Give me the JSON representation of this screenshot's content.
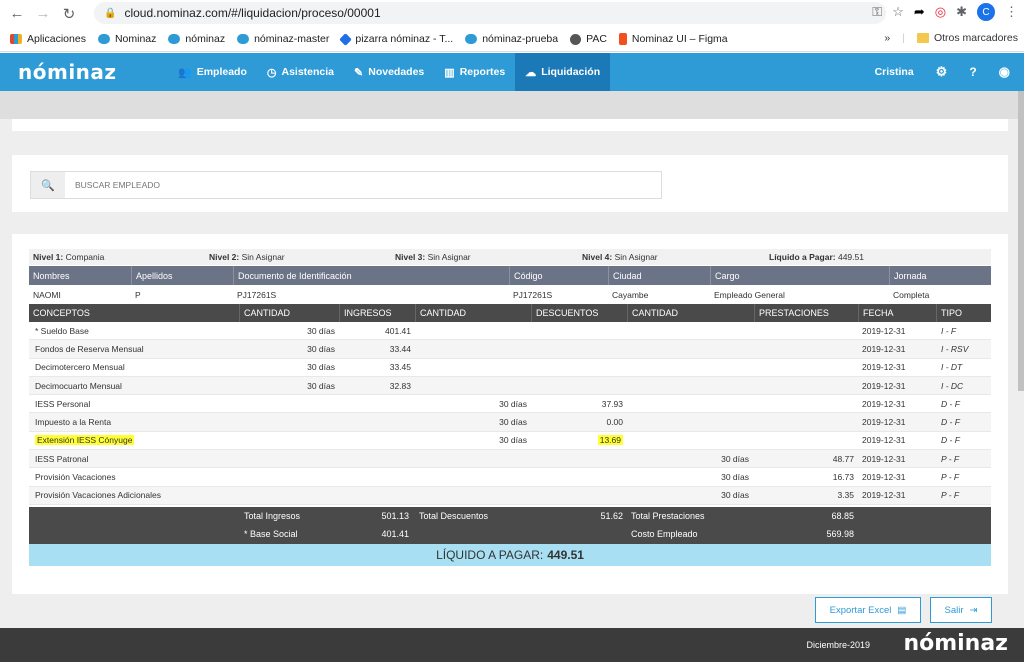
{
  "browser": {
    "url": "cloud.nominaz.com/#/liquidacion/proceso/00001",
    "avatar_letter": "C",
    "bookmarks": [
      {
        "label": "Aplicaciones",
        "color": "#e0482e"
      },
      {
        "label": "Nominaz",
        "color": "#2e9bd6"
      },
      {
        "label": "nóminaz",
        "color": "#2e9bd6"
      },
      {
        "label": "nóminaz-master",
        "color": "#2e9bd6"
      },
      {
        "label": "pizarra nóminaz - T...",
        "color": "#1e6fe8"
      },
      {
        "label": "nóminaz-prueba",
        "color": "#2e9bd6"
      },
      {
        "label": "PAC",
        "color": "#555555"
      },
      {
        "label": "Nominaz UI – Figma",
        "color": "#f24e1e"
      }
    ],
    "more_bookmarks": "»",
    "other_bookmarks": "Otros marcadores"
  },
  "app": {
    "logo": "nóminaz",
    "nav": [
      {
        "label": "Empleado",
        "icon": "users-icon",
        "glyph": "👥"
      },
      {
        "label": "Asistencia",
        "icon": "clock-icon",
        "glyph": "◷"
      },
      {
        "label": "Novedades",
        "icon": "edit-icon",
        "glyph": "✎"
      },
      {
        "label": "Reportes",
        "icon": "bar-chart-icon",
        "glyph": "▥"
      },
      {
        "label": "Liquidación",
        "icon": "cloud-upload-icon",
        "glyph": "☁"
      }
    ],
    "user": "Cristina",
    "active_color": "#1b79b8",
    "brand_color": "#2e9bd6"
  },
  "search": {
    "placeholder": "BUSCAR EMPLEADO"
  },
  "levels": {
    "nivel1_label": "Nivel 1:",
    "nivel1": "Compania",
    "nivel2_label": "Nivel 2:",
    "nivel2": "Sin Asignar",
    "nivel3_label": "Nivel 3:",
    "nivel3": "Sin Asignar",
    "nivel4_label": "Nivel 4:",
    "nivel4": "Sin Asignar",
    "liquido_label": "Líquido a Pagar:",
    "liquido": "449.51"
  },
  "employee": {
    "headers": [
      "Nombres",
      "Apellidos",
      "Documento de Identificación",
      "Código",
      "Ciudad",
      "Cargo",
      "Jornada"
    ],
    "values": [
      "NAOMI",
      "P",
      "PJ17261S",
      "PJ17261S",
      "Cayambe",
      "Empleado General",
      "Completa"
    ]
  },
  "concepts": {
    "headers": [
      "CONCEPTOS",
      "CANTIDAD",
      "INGRESOS",
      "CANTIDAD",
      "DESCUENTOS",
      "CANTIDAD",
      "PRESTACIONES",
      "FECHA",
      "TIPO"
    ],
    "rows": [
      {
        "concepto": "* Sueldo Base",
        "cant_ing": "30 días",
        "ingresos": "401.41",
        "cant_desc": "",
        "descuentos": "",
        "cant_prest": "",
        "prestaciones": "",
        "fecha": "2019-12-31",
        "tipo": "I - F"
      },
      {
        "concepto": "Fondos de Reserva Mensual",
        "cant_ing": "30 días",
        "ingresos": "33.44",
        "cant_desc": "",
        "descuentos": "",
        "cant_prest": "",
        "prestaciones": "",
        "fecha": "2019-12-31",
        "tipo": "I - RSV"
      },
      {
        "concepto": "Decimotercero Mensual",
        "cant_ing": "30 días",
        "ingresos": "33.45",
        "cant_desc": "",
        "descuentos": "",
        "cant_prest": "",
        "prestaciones": "",
        "fecha": "2019-12-31",
        "tipo": "I - DT"
      },
      {
        "concepto": "Decimocuarto Mensual",
        "cant_ing": "30 días",
        "ingresos": "32.83",
        "cant_desc": "",
        "descuentos": "",
        "cant_prest": "",
        "prestaciones": "",
        "fecha": "2019-12-31",
        "tipo": "I - DC"
      },
      {
        "concepto": "IESS Personal",
        "cant_ing": "",
        "ingresos": "",
        "cant_desc": "30 días",
        "descuentos": "37.93",
        "cant_prest": "",
        "prestaciones": "",
        "fecha": "2019-12-31",
        "tipo": "D - F"
      },
      {
        "concepto": "Impuesto a la Renta",
        "cant_ing": "",
        "ingresos": "",
        "cant_desc": "30 días",
        "descuentos": "0.00",
        "cant_prest": "",
        "prestaciones": "",
        "fecha": "2019-12-31",
        "tipo": "D - F"
      },
      {
        "concepto": "Extensión IESS Cónyuge",
        "cant_ing": "",
        "ingresos": "",
        "cant_desc": "30 días",
        "descuentos": "13.69",
        "cant_prest": "",
        "prestaciones": "",
        "fecha": "2019-12-31",
        "tipo": "D - F",
        "highlight": true
      },
      {
        "concepto": "IESS Patronal",
        "cant_ing": "",
        "ingresos": "",
        "cant_desc": "",
        "descuentos": "",
        "cant_prest": "30 días",
        "prestaciones": "48.77",
        "fecha": "2019-12-31",
        "tipo": "P - F"
      },
      {
        "concepto": "Provisión Vacaciones",
        "cant_ing": "",
        "ingresos": "",
        "cant_desc": "",
        "descuentos": "",
        "cant_prest": "30 días",
        "prestaciones": "16.73",
        "fecha": "2019-12-31",
        "tipo": "P - F"
      },
      {
        "concepto": "Provisión Vacaciones Adicionales",
        "cant_ing": "",
        "ingresos": "",
        "cant_desc": "",
        "descuentos": "",
        "cant_prest": "30 días",
        "prestaciones": "3.35",
        "fecha": "2019-12-31",
        "tipo": "P - F"
      }
    ],
    "highlight_color": "#ffff33"
  },
  "totals": {
    "total_ingresos_label": "Total Ingresos",
    "total_ingresos": "501.13",
    "total_descuentos_label": "Total Descuentos",
    "total_descuentos": "51.62",
    "total_prestaciones_label": "Total Prestaciones",
    "total_prestaciones": "68.85",
    "base_social_label": "* Base Social",
    "base_social": "401.41",
    "costo_empleado_label": "Costo Empleado",
    "costo_empleado": "569.98"
  },
  "liquido_banner": {
    "label": "LÍQUIDO A PAGAR:",
    "value": "449.51"
  },
  "actions": {
    "export": "Exportar Excel",
    "exit": "Salir"
  },
  "footer": {
    "date": "Diciembre-2019",
    "logo": "nóminaz"
  }
}
